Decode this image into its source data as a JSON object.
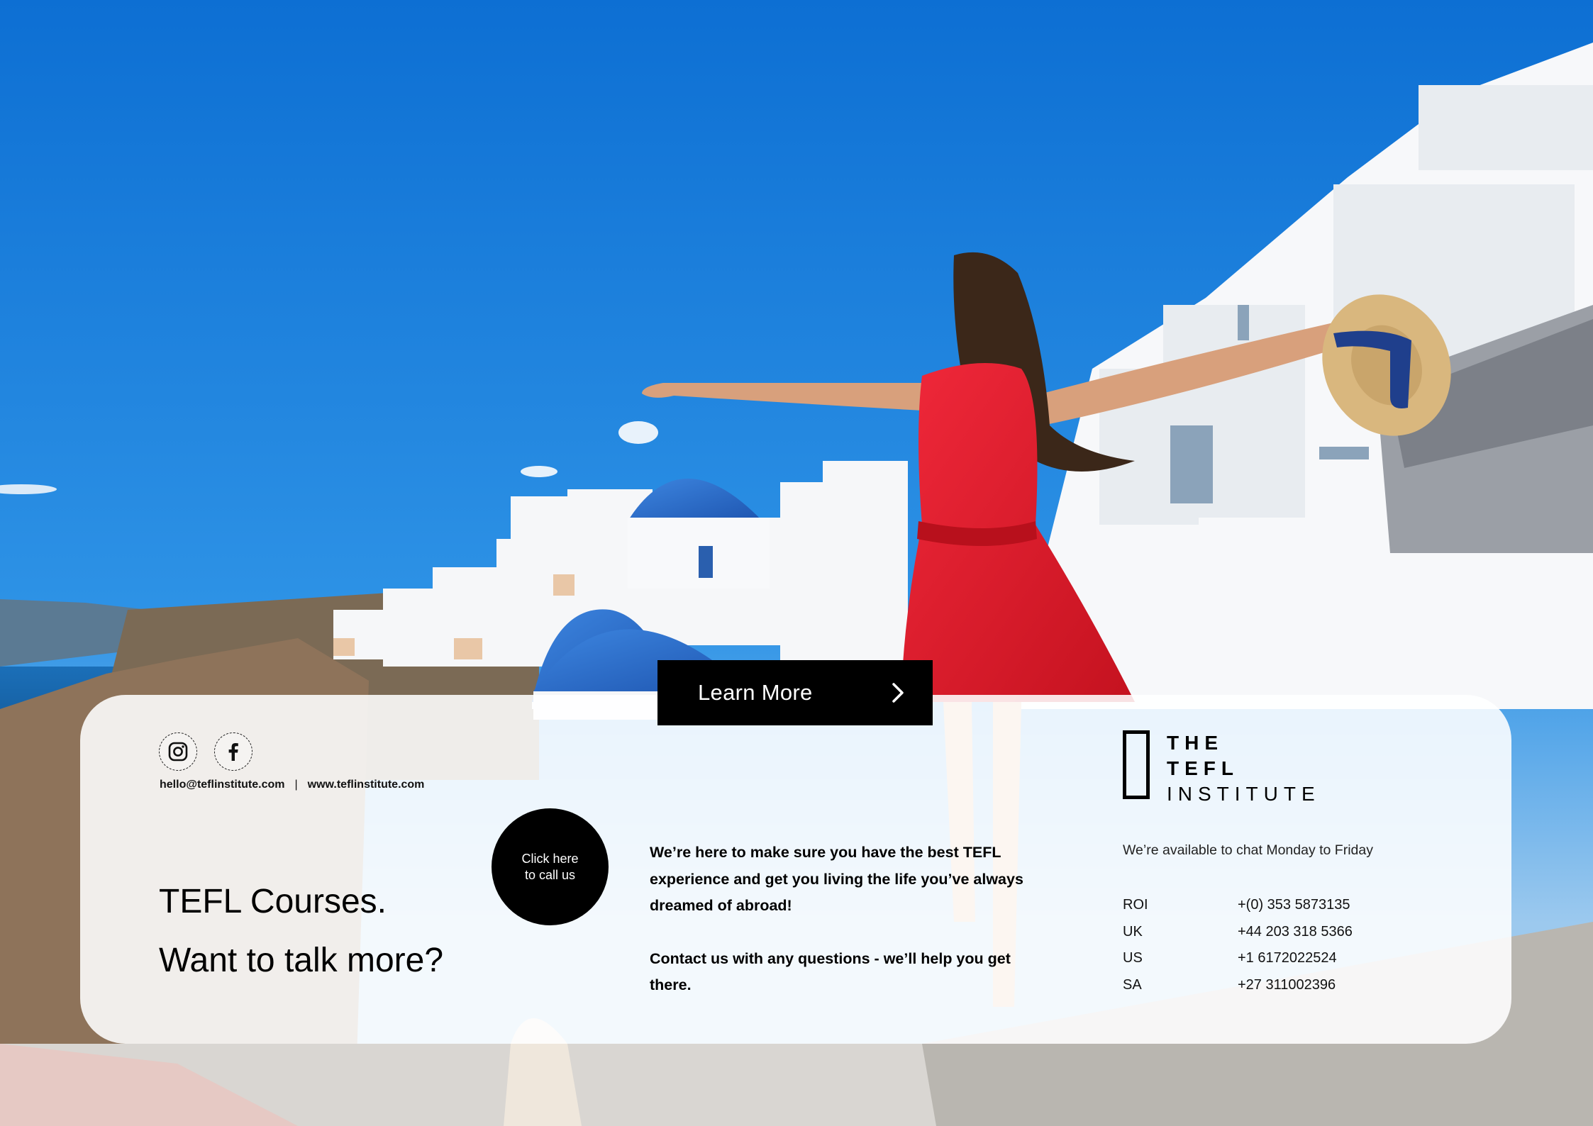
{
  "hero": {
    "cta_label": "Learn More",
    "cta_icon": "chevron-right-icon"
  },
  "social": {
    "instagram_icon": "instagram-icon",
    "facebook_icon": "facebook-icon"
  },
  "contact": {
    "email": "hello@teflinstitute.com",
    "separator": "|",
    "website": "www.teflinstitute.com"
  },
  "headline": {
    "line1": "TEFL Courses.",
    "line2": "Want to talk more?"
  },
  "call_button": {
    "line1": "Click here",
    "line2": "to call us"
  },
  "message": {
    "p1": "We’re here to make sure you have the best TEFL experience and get you living the life you’ve always dreamed of abroad!",
    "p2": "Contact us with any questions - we’ll help you get there."
  },
  "logo": {
    "line1": "THE",
    "line2": "TEFL",
    "line3": "INSTITUTE"
  },
  "availability": "We’re available to chat Monday to Friday",
  "phones": [
    {
      "country": "ROI",
      "number": "+(0) 353 5873135"
    },
    {
      "country": "UK",
      "number": "+44 203 318 5366"
    },
    {
      "country": "US",
      "number": "+1 6172022524"
    },
    {
      "country": "SA",
      "number": "+27 311002396"
    }
  ],
  "colors": {
    "sky": "#1a7fd6",
    "dress": "#e2202f",
    "dome": "#2f6fd0",
    "accent": "#000000"
  }
}
